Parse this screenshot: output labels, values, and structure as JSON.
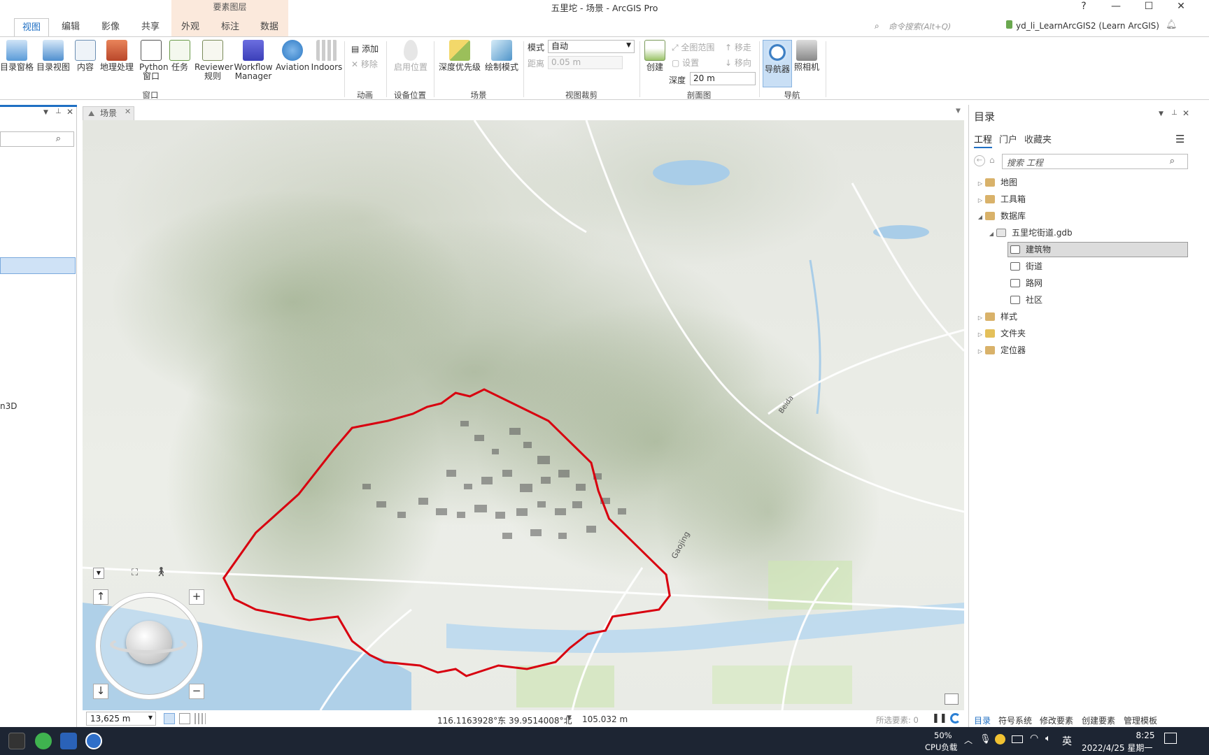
{
  "window": {
    "title": "五里坨 - 场景 - ArcGIS Pro",
    "contextual_group": "要素图层",
    "help": "?",
    "minimize": "—",
    "maximize": "☐",
    "close": "✕"
  },
  "ribbon_tabs": [
    "视图",
    "编辑",
    "影像",
    "共享",
    "外观",
    "标注",
    "数据"
  ],
  "header": {
    "command_search_placeholder": "命令搜索(Alt+Q)",
    "user": "yd_li_LearnArcGIS2 (Learn ArcGIS)"
  },
  "ribbon": {
    "window_group": {
      "label": "窗口",
      "buttons": [
        "目录窗格",
        "目录视图",
        "内容",
        "地理处理",
        "Python 窗口",
        "任务",
        "Reviewer 规则",
        "Workflow Manager",
        "Aviation",
        "Indoors"
      ]
    },
    "animation_group": {
      "label": "动画",
      "add": "添加",
      "remove": "移除"
    },
    "device_group": {
      "label": "设备位置",
      "enable": "启用位置"
    },
    "scene_group": {
      "label": "场景",
      "depth_priority": "深度优先级",
      "draw_mode": "绘制模式"
    },
    "clip_group": {
      "label": "视图裁剪",
      "mode_label": "模式",
      "mode_value": "自动",
      "distance_label": "距离",
      "distance_value": "0.05 m"
    },
    "section_group": {
      "label": "剖面图",
      "create": "创建",
      "full_extent": "全图范围",
      "settings": "设置",
      "move_up": "移走",
      "move_toward": "移向",
      "depth_label": "深度",
      "depth_value": "20 m"
    },
    "nav_group": {
      "label": "导航",
      "navigator": "导航器",
      "camera": "照相机"
    }
  },
  "view": {
    "tab_label": "场景",
    "scale": "13,625 m",
    "coordinates": "116.1163928°东 39.9514008°北",
    "elevation": "105.032 m",
    "selected_features": "所选要素: 0"
  },
  "left_pane": {
    "partial_text": "n3D"
  },
  "catalog": {
    "title": "目录",
    "tabs": [
      "工程",
      "门户",
      "收藏夹"
    ],
    "search_placeholder": "搜索 工程",
    "tree": {
      "maps": "地图",
      "toolboxes": "工具箱",
      "databases": "数据库",
      "gdb": "五里坨街道.gdb",
      "fc_buildings": "建筑物",
      "fc_streets": "街道",
      "fc_network": "路网",
      "fc_community": "社区",
      "styles": "样式",
      "folders": "文件夹",
      "locators": "定位器"
    },
    "bottom_tabs": [
      "目录",
      "符号系统",
      "修改要素",
      "创建要素",
      "管理模板"
    ]
  },
  "map_labels": [
    "Beida",
    "Gaojing"
  ],
  "taskbar": {
    "cpu_percent": "50%",
    "cpu_label": "CPU负载",
    "ime": "英",
    "time": "8:25",
    "date": "2022/4/25 星期一"
  },
  "colors": {
    "accent": "#1f6fc3",
    "boundary": "#d8000f",
    "water": "#a9cde8"
  }
}
